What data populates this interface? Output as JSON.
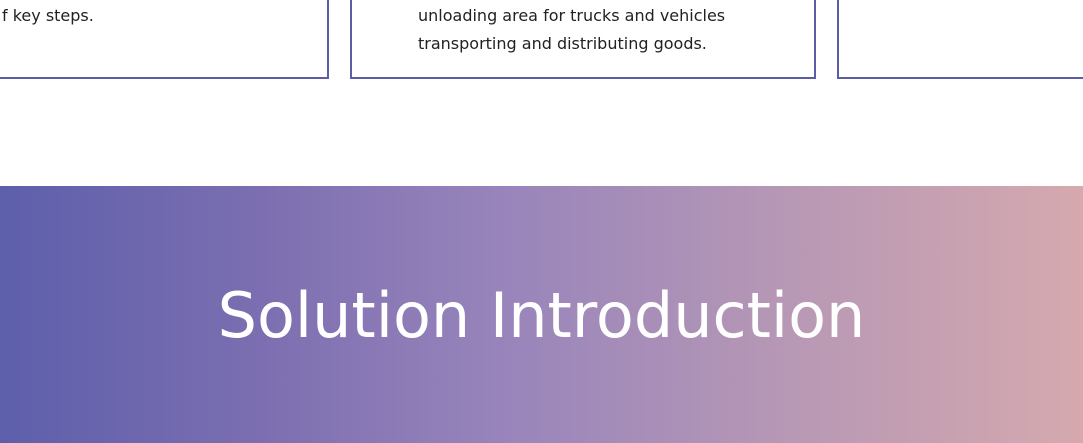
{
  "cards": {
    "left": {
      "text": "f key steps."
    },
    "middle": {
      "line1": "unloading area for trucks and vehicles",
      "line2": "transporting and distributing goods."
    },
    "right": {
      "text": ""
    }
  },
  "banner": {
    "title": "Solution Introduction",
    "gradient_colors": [
      "#5d5fab",
      "#9a86bb",
      "#d5a9ae"
    ]
  },
  "colors": {
    "card_border": "#5b5ea6",
    "text": "#222222",
    "banner_title": "#ffffff"
  }
}
